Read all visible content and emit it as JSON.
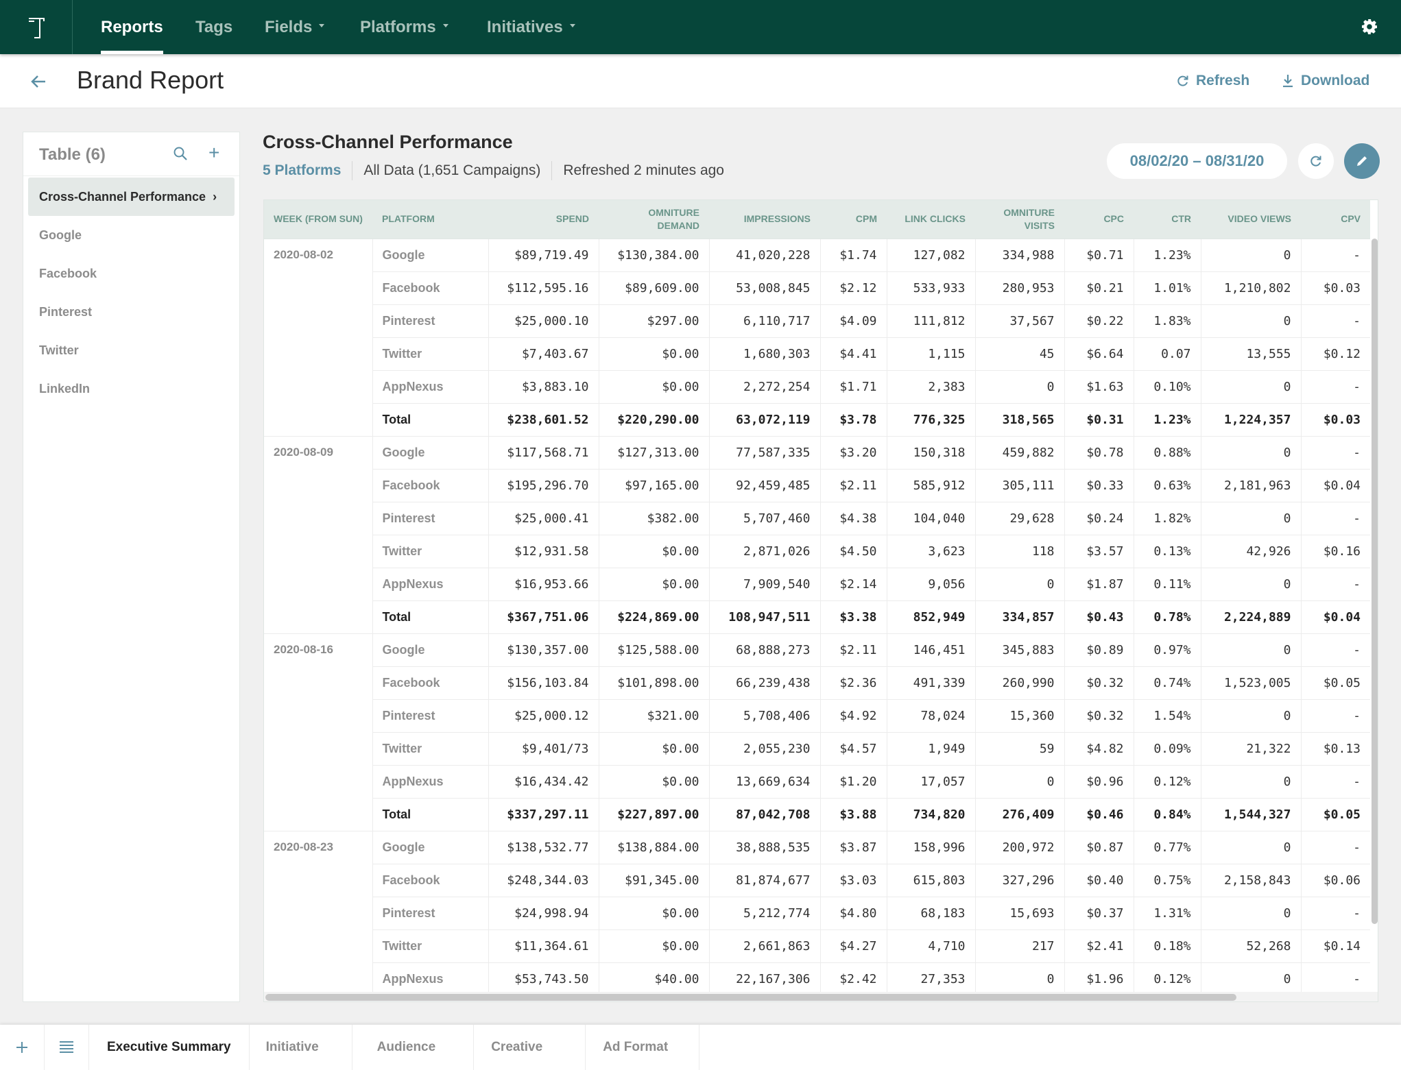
{
  "nav": {
    "logo_icon": "brand-logo-t",
    "items": [
      {
        "label": "Reports",
        "active": true,
        "dropdown": false
      },
      {
        "label": "Tags",
        "active": false,
        "dropdown": false
      },
      {
        "label": "Fields",
        "active": false,
        "dropdown": true
      },
      {
        "label": "Platforms",
        "active": false,
        "dropdown": true
      },
      {
        "label": "Initiatives",
        "active": false,
        "dropdown": true
      }
    ],
    "settings_icon": "gear-icon"
  },
  "header": {
    "title": "Brand Report",
    "refresh_label": "Refresh",
    "download_label": "Download"
  },
  "sidebar": {
    "title": "Table (6)",
    "items": [
      {
        "label": "Cross-Channel Performance",
        "active": true
      },
      {
        "label": "Google",
        "active": false
      },
      {
        "label": "Facebook",
        "active": false
      },
      {
        "label": "Pinterest",
        "active": false
      },
      {
        "label": "Twitter",
        "active": false
      },
      {
        "label": "LinkedIn",
        "active": false
      }
    ]
  },
  "report": {
    "title": "Cross-Channel Performance",
    "platforms_link": "5 Platforms",
    "data_scope": "All Data (1,651 Campaigns)",
    "refreshed": "Refreshed 2 minutes ago",
    "date_range": "08/02/20 – 08/31/20"
  },
  "table": {
    "columns": [
      "WEEK (FROM SUN)",
      "PLATFORM",
      "SPEND",
      "OMNITURE DEMAND",
      "IMPRESSIONS",
      "CPM",
      "LINK CLICKS",
      "OMNITURE VISITS",
      "CPC",
      "CTR",
      "VIDEO VIEWS",
      "CPV"
    ],
    "groups": [
      {
        "week": "2020-08-02",
        "rows": [
          [
            "Google",
            "$89,719.49",
            "$130,384.00",
            "41,020,228",
            "$1.74",
            "127,082",
            "334,988",
            "$0.71",
            "1.23%",
            "0",
            "-"
          ],
          [
            "Facebook",
            "$112,595.16",
            "$89,609.00",
            "53,008,845",
            "$2.12",
            "533,933",
            "280,953",
            "$0.21",
            "1.01%",
            "1,210,802",
            "$0.03"
          ],
          [
            "Pinterest",
            "$25,000.10",
            "$297.00",
            "6,110,717",
            "$4.09",
            "111,812",
            "37,567",
            "$0.22",
            "1.83%",
            "0",
            "-"
          ],
          [
            "Twitter",
            "$7,403.67",
            "$0.00",
            "1,680,303",
            "$4.41",
            "1,115",
            "45",
            "$6.64",
            "0.07",
            "13,555",
            "$0.12"
          ],
          [
            "AppNexus",
            "$3,883.10",
            "$0.00",
            "2,272,254",
            "$1.71",
            "2,383",
            "0",
            "$1.63",
            "0.10%",
            "0",
            "-"
          ],
          [
            "Total",
            "$238,601.52",
            "$220,290.00",
            "63,072,119",
            "$3.78",
            "776,325",
            "318,565",
            "$0.31",
            "1.23%",
            "1,224,357",
            "$0.03"
          ]
        ]
      },
      {
        "week": "2020-08-09",
        "rows": [
          [
            "Google",
            "$117,568.71",
            "$127,313.00",
            "77,587,335",
            "$3.20",
            "150,318",
            "459,882",
            "$0.78",
            "0.88%",
            "0",
            "-"
          ],
          [
            "Facebook",
            "$195,296.70",
            "$97,165.00",
            "92,459,485",
            "$2.11",
            "585,912",
            "305,111",
            "$0.33",
            "0.63%",
            "2,181,963",
            "$0.04"
          ],
          [
            "Pinterest",
            "$25,000.41",
            "$382.00",
            "5,707,460",
            "$4.38",
            "104,040",
            "29,628",
            "$0.24",
            "1.82%",
            "0",
            "-"
          ],
          [
            "Twitter",
            "$12,931.58",
            "$0.00",
            "2,871,026",
            "$4.50",
            "3,623",
            "118",
            "$3.57",
            "0.13%",
            "42,926",
            "$0.16"
          ],
          [
            "AppNexus",
            "$16,953.66",
            "$0.00",
            "7,909,540",
            "$2.14",
            "9,056",
            "0",
            "$1.87",
            "0.11%",
            "0",
            "-"
          ],
          [
            "Total",
            "$367,751.06",
            "$224,869.00",
            "108,947,511",
            "$3.38",
            "852,949",
            "334,857",
            "$0.43",
            "0.78%",
            "2,224,889",
            "$0.04"
          ]
        ]
      },
      {
        "week": "2020-08-16",
        "rows": [
          [
            "Google",
            "$130,357.00",
            "$125,588.00",
            "68,888,273",
            "$2.11",
            "146,451",
            "345,883",
            "$0.89",
            "0.97%",
            "0",
            "-"
          ],
          [
            "Facebook",
            "$156,103.84",
            "$101,898.00",
            "66,239,438",
            "$2.36",
            "491,339",
            "260,990",
            "$0.32",
            "0.74%",
            "1,523,005",
            "$0.05"
          ],
          [
            "Pinterest",
            "$25,000.12",
            "$321.00",
            "5,708,406",
            "$4.92",
            "78,024",
            "15,360",
            "$0.32",
            "1.54%",
            "0",
            "-"
          ],
          [
            "Twitter",
            "$9,401/73",
            "$0.00",
            "2,055,230",
            "$4.57",
            "1,949",
            "59",
            "$4.82",
            "0.09%",
            "21,322",
            "$0.13"
          ],
          [
            "AppNexus",
            "$16,434.42",
            "$0.00",
            "13,669,634",
            "$1.20",
            "17,057",
            "0",
            "$0.96",
            "0.12%",
            "0",
            "-"
          ],
          [
            "Total",
            "$337,297.11",
            "$227,897.00",
            "87,042,708",
            "$3.88",
            "734,820",
            "276,409",
            "$0.46",
            "0.84%",
            "1,544,327",
            "$0.05"
          ]
        ]
      },
      {
        "week": "2020-08-23",
        "rows": [
          [
            "Google",
            "$138,532.77",
            "$138,884.00",
            "38,888,535",
            "$3.87",
            "158,996",
            "200,972",
            "$0.87",
            "0.77%",
            "0",
            "-"
          ],
          [
            "Facebook",
            "$248,344.03",
            "$91,345.00",
            "81,874,677",
            "$3.03",
            "615,803",
            "327,296",
            "$0.40",
            "0.75%",
            "2,158,843",
            "$0.06"
          ],
          [
            "Pinterest",
            "$24,998.94",
            "$0.00",
            "5,212,774",
            "$4.80",
            "68,183",
            "15,693",
            "$0.37",
            "1.31%",
            "0",
            "-"
          ],
          [
            "Twitter",
            "$11,364.61",
            "$0.00",
            "2,661,863",
            "$4.27",
            "4,710",
            "217",
            "$2.41",
            "0.18%",
            "52,268",
            "$0.14"
          ],
          [
            "AppNexus",
            "$53,743.50",
            "$40.00",
            "22,167,306",
            "$2.42",
            "27,353",
            "0",
            "$1.96",
            "0.12%",
            "0",
            "-"
          ]
        ]
      }
    ]
  },
  "bottom_tabs": {
    "add_icon": "plus-icon",
    "list_icon": "list-icon",
    "tabs": [
      {
        "label": "Executive Summary",
        "active": true
      },
      {
        "label": "Initiative",
        "active": false
      },
      {
        "label": "Audience",
        "active": false
      },
      {
        "label": "Creative",
        "active": false
      },
      {
        "label": "Ad Format",
        "active": false
      }
    ]
  },
  "colors": {
    "nav_bg": "#06463a",
    "accent": "#5b8fa5",
    "header_row_bg": "#e4ebe8",
    "header_text": "#6a958a"
  }
}
